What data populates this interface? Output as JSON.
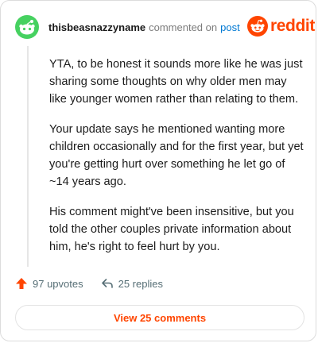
{
  "header": {
    "username": "thisbeasnazzyname",
    "action": "commented on",
    "post_link": "post",
    "avatar_icon": "snoo-avatar-icon",
    "brand_icon": "reddit-logo-icon",
    "brand_word": "reddit"
  },
  "comment": {
    "paragraphs": [
      "YTA, to be honest it sounds more like he was just sharing some thoughts on why older men may like younger women rather than relating to them.",
      "Your update says he mentioned wanting more children occasionally and for the first year, but yet you're getting hurt over something he let go of ~14 years ago.",
      "His comment might've been insensitive, but you told the other couples private information about him, he's right to feel hurt by you."
    ]
  },
  "footer": {
    "upvotes": "97 upvotes",
    "replies": "25 replies",
    "upvote_icon": "upvote-arrow-icon",
    "reply_icon": "reply-icon"
  },
  "view_button": {
    "label": "View 25 comments"
  },
  "colors": {
    "accent": "#ff4500",
    "link": "#0079d3",
    "avatar_green": "#46d160"
  }
}
